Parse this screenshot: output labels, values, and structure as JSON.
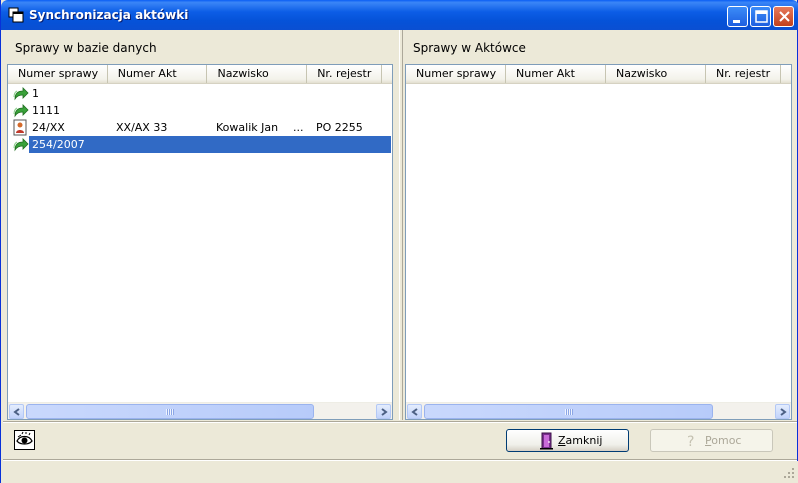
{
  "window": {
    "title": "Synchronizacja aktówki"
  },
  "left_panel": {
    "label": "Sprawy w bazie danych",
    "columns": [
      "Numer sprawy",
      "Numer Akt",
      "Nazwisko",
      "Nr. rejestr"
    ],
    "rows": [
      {
        "icon": "green-arrow-icon",
        "numer_sprawy": "1",
        "numer_akt": "",
        "nazwisko": "",
        "extra": "",
        "nr_rejestr": "",
        "selected": false
      },
      {
        "icon": "green-arrow-icon",
        "numer_sprawy": "1111",
        "numer_akt": "",
        "nazwisko": "",
        "extra": "",
        "nr_rejestr": "",
        "selected": false
      },
      {
        "icon": "person-document-icon",
        "numer_sprawy": "24/XX",
        "numer_akt": "XX/AX 33",
        "nazwisko": "Kowalik Jan",
        "extra": "...",
        "nr_rejestr": "PO 2255",
        "selected": false
      },
      {
        "icon": "green-arrow-icon",
        "numer_sprawy": "254/2007",
        "numer_akt": "",
        "nazwisko": "",
        "extra": "",
        "nr_rejestr": "",
        "selected": true
      }
    ],
    "scroll_grip": "III"
  },
  "right_panel": {
    "label": "Sprawy w Aktówce",
    "columns": [
      "Numer sprawy",
      "Numer Akt",
      "Nazwisko",
      "Nr. rejestr"
    ],
    "rows": [],
    "scroll_grip": "III"
  },
  "buttons": {
    "close_label": "Zamknij",
    "help_label": "Pomoc"
  },
  "colors": {
    "titlebar": "#0a5ef4",
    "selection": "#316ac5",
    "face": "#ece9d8"
  }
}
